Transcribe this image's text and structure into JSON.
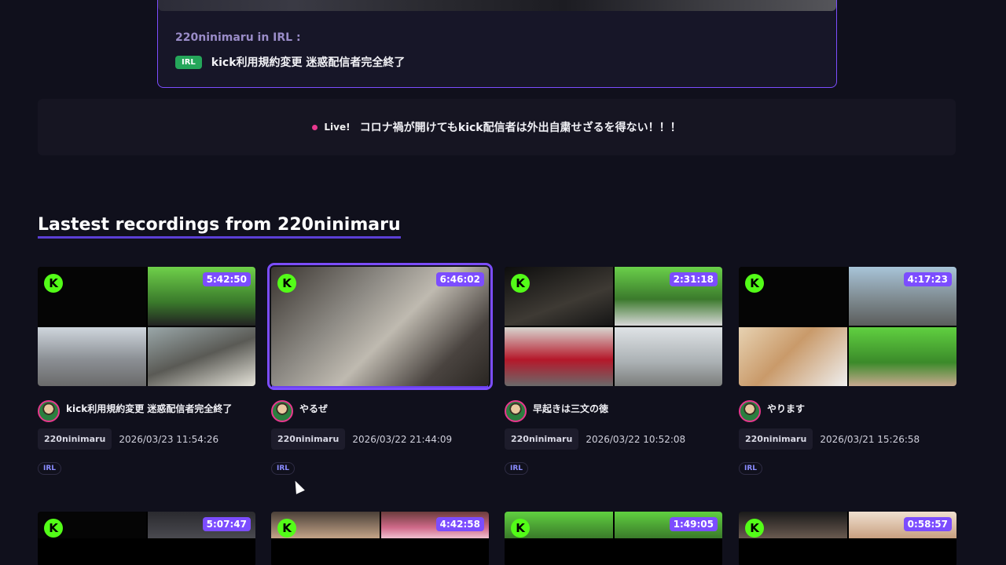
{
  "stream": {
    "channel_line": "220ninimaru in IRL :",
    "badge": "IRL",
    "title": "kick利用規約変更 迷惑配信者完全終了"
  },
  "live": {
    "label": "Live!",
    "title": "コロナ禍が開けてもkick配信者は外出自粛せざるを得ない！！！"
  },
  "section": {
    "title": "Lastest recordings from 220ninimaru"
  },
  "recordings": [
    {
      "duration": "5:42:50",
      "title": "kick利用規約変更 迷惑配信者完全終了",
      "channel": "220ninimaru",
      "date": "2026/03/23 11:54:26",
      "tag": "IRL"
    },
    {
      "duration": "6:46:02",
      "title": "やるぜ",
      "channel": "220ninimaru",
      "date": "2026/03/22 21:44:09",
      "tag": "IRL"
    },
    {
      "duration": "2:31:18",
      "title": "早起きは三文の徳",
      "channel": "220ninimaru",
      "date": "2026/03/22 10:52:08",
      "tag": "IRL"
    },
    {
      "duration": "4:17:23",
      "title": "やります",
      "channel": "220ninimaru",
      "date": "2026/03/21 15:26:58",
      "tag": "IRL"
    }
  ],
  "recordings_row2": [
    {
      "duration": "5:07:47"
    },
    {
      "duration": "4:42:58"
    },
    {
      "duration": "1:49:05"
    },
    {
      "duration": "0:58:57"
    }
  ],
  "colors": {
    "accent": "#7c4dff",
    "live": "#e8388e",
    "irl_badge": "#25a65a",
    "kick_green": "#53fc18"
  }
}
